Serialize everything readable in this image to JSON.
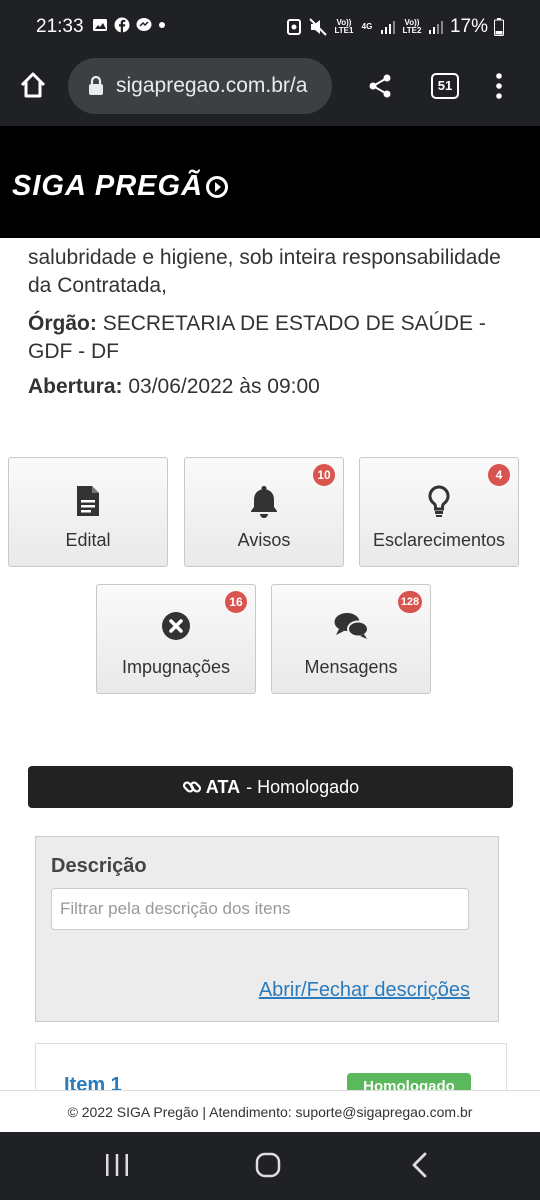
{
  "status_bar": {
    "time": "21:33",
    "battery": "17%",
    "net_label_1": "Vo)) LTE1",
    "net_label_2": "4G",
    "net_label_3": "Vo)) LTE2"
  },
  "browser": {
    "url": "sigapregao.com.br/a",
    "tab_count": "51"
  },
  "site": {
    "logo_text": "SIGA PREGÃ"
  },
  "notice": {
    "description_fragment": "salubridade e higiene, sob inteira responsabilidade da Contratada,",
    "orgao_label": "Órgão:",
    "orgao_value": "SECRETARIA DE ESTADO DE SAÚDE - GDF - DF",
    "abertura_label": "Abertura:",
    "abertura_value": "03/06/2022 às 09:00"
  },
  "actions": {
    "edital": {
      "label": "Edital",
      "icon": "document-icon"
    },
    "avisos": {
      "label": "Avisos",
      "badge": "10",
      "icon": "bell-icon"
    },
    "esclarecimentos": {
      "label": "Esclarecimentos",
      "badge": "4",
      "icon": "lightbulb-icon"
    },
    "impugnacoes": {
      "label": "Impugnações",
      "badge": "16",
      "icon": "x-circle-icon"
    },
    "mensagens": {
      "label": "Mensagens",
      "badge": "128",
      "icon": "chat-icon"
    }
  },
  "ata": {
    "bold": "ATA",
    "rest": "- Homologado"
  },
  "filter": {
    "title": "Descrição",
    "placeholder": "Filtrar pela descrição dos itens",
    "toggle_link": "Abrir/Fechar descrições"
  },
  "item": {
    "title": "Item 1",
    "status": "Homologado"
  },
  "footer": {
    "text": "© 2022 SIGA Pregão | Atendimento: suporte@sigapregao.com.br"
  },
  "colors": {
    "badge": "#d9534f",
    "link": "#2a7bbd",
    "status_green": "#5cb85c"
  }
}
